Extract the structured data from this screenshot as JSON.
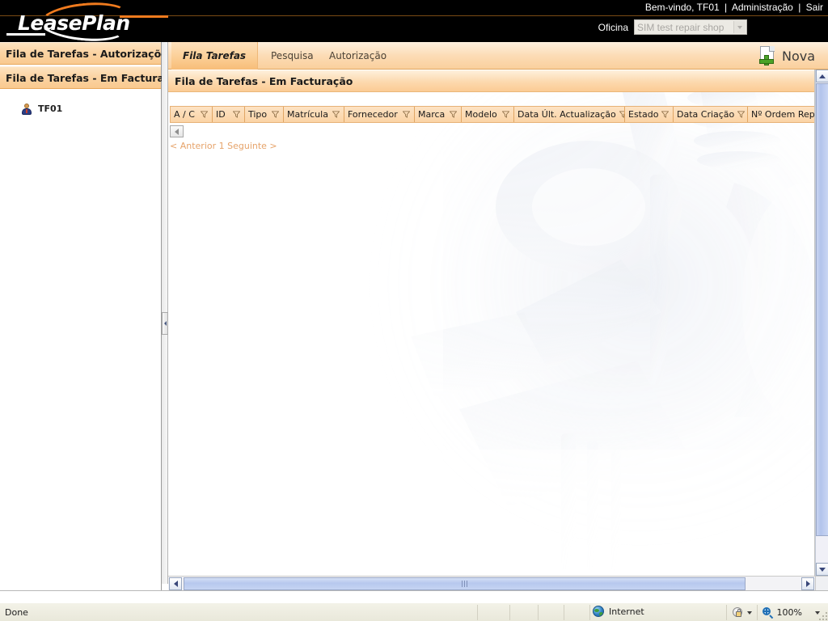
{
  "header": {
    "logo_text": "LeasePlan",
    "welcome_prefix": "Bem-vindo,",
    "username": "TF01",
    "admin_link": "Administração",
    "logout_link": "Sair",
    "separator": "|",
    "oficina_label": "Oficina",
    "oficina_selected": "SIM test repair shop"
  },
  "sidebar": {
    "items": [
      {
        "label": "Fila de Tarefas - Autorizações"
      },
      {
        "label": "Fila de Tarefas - Em Facturação"
      }
    ],
    "user": {
      "label": "TF01"
    }
  },
  "tabs": [
    {
      "label": "Fila Tarefas",
      "active": true
    },
    {
      "label": "Pesquisa",
      "active": false
    },
    {
      "label": "Autorização",
      "active": false
    }
  ],
  "toolbar": {
    "nova_label": "Nova"
  },
  "panel": {
    "title": "Fila de Tarefas - Em Facturação"
  },
  "grid": {
    "columns": [
      {
        "label": "A / C",
        "width": 52
      },
      {
        "label": "ID",
        "width": 40
      },
      {
        "label": "Tipo",
        "width": 48
      },
      {
        "label": "Matrícula",
        "width": 75
      },
      {
        "label": "Fornecedor",
        "width": 87
      },
      {
        "label": "Marca",
        "width": 58
      },
      {
        "label": "Modelo",
        "width": 65
      },
      {
        "label": "Data Últ. Actualização",
        "width": 137
      },
      {
        "label": "Estado",
        "width": 60
      },
      {
        "label": "Data Criação",
        "width": 92
      },
      {
        "label": "Nº Ordem Reparação",
        "width": 130
      }
    ],
    "rows": [],
    "filter_icon": "funnel-icon"
  },
  "pager": {
    "prev_label": "< Anterior",
    "page_number": "1",
    "next_label": "Seguinte >",
    "back_button_icon": "chevron-left-icon"
  },
  "statusbar": {
    "message": "Done",
    "zone": "Internet",
    "zoom": "100%"
  },
  "colors": {
    "accent_orange": "#F07B1E",
    "header_black": "#000000",
    "panel_orange": "#FBD4A6",
    "link_orange": "#E6A36A",
    "scroll_blue": "#B7C8EE"
  }
}
